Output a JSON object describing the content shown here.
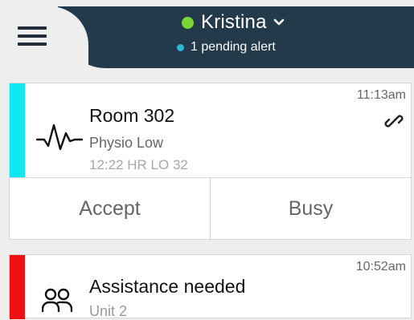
{
  "header": {
    "user_name": "Kristina",
    "status_color": "#7bd636",
    "alert_text": "1 pending alert",
    "alert_dot_color": "#2fb3d6",
    "menu_icon": "hamburger-menu-icon",
    "dropdown_icon": "chevron-down-icon"
  },
  "alerts": [
    {
      "time": "11:13am",
      "title": "Room 302",
      "subtitle": "Physio Low",
      "detail": "12:22 HR LO 32",
      "stripe_color": "#12e6f2",
      "icon": "heartbeat-waveform-icon",
      "attachment_icon": "link-icon",
      "actions": {
        "accept_label": "Accept",
        "busy_label": "Busy"
      }
    },
    {
      "time": "10:52am",
      "title": "Assistance needed",
      "subtitle": "Unit 2",
      "stripe_color": "#ee1111",
      "icon": "people-icon"
    }
  ]
}
